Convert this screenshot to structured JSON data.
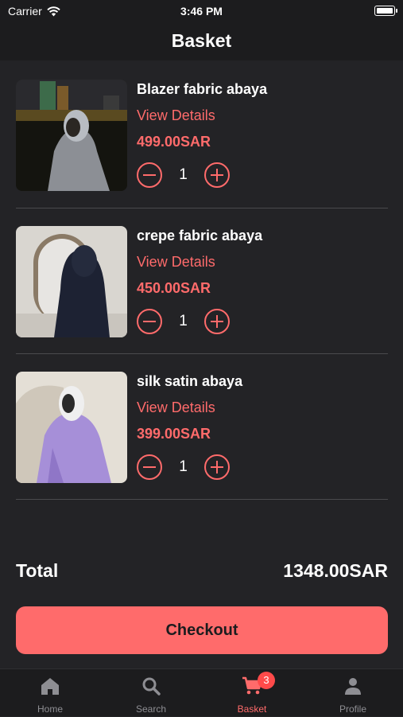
{
  "status_bar": {
    "carrier": "Carrier",
    "time": "3:46 PM"
  },
  "header": {
    "title": "Basket"
  },
  "items": [
    {
      "name": "Blazer fabric abaya",
      "details_label": "View Details",
      "price": "499.00SAR",
      "quantity": "1"
    },
    {
      "name": "crepe fabric abaya",
      "details_label": "View Details",
      "price": "450.00SAR",
      "quantity": "1"
    },
    {
      "name": "silk satin abaya",
      "details_label": "View Details",
      "price": "399.00SAR",
      "quantity": "1"
    }
  ],
  "summary": {
    "total_label": "Total",
    "total_value": "1348.00SAR"
  },
  "checkout": {
    "label": "Checkout"
  },
  "tabbar": {
    "tabs": [
      {
        "label": "Home",
        "icon": "home-icon"
      },
      {
        "label": "Search",
        "icon": "search-icon"
      },
      {
        "label": "Basket",
        "icon": "cart-icon",
        "badge": "3",
        "active": true
      },
      {
        "label": "Profile",
        "icon": "person-icon"
      }
    ]
  },
  "colors": {
    "accent": "#ff6b6b",
    "background": "#232326",
    "bar": "#1c1c1e",
    "badge": "#ff4a4a"
  }
}
